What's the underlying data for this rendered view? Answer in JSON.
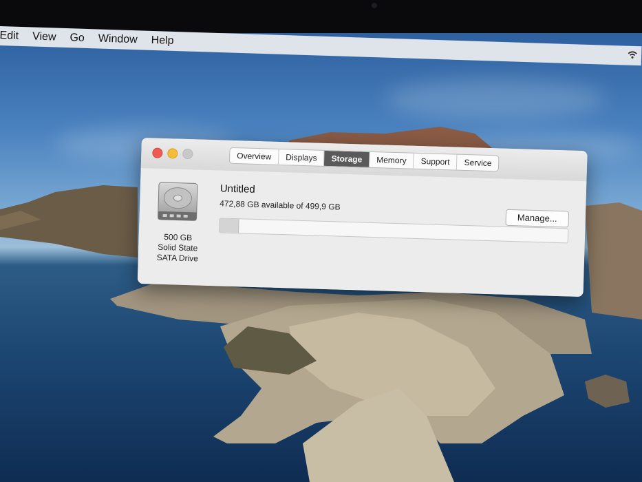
{
  "menubar": {
    "items": [
      "Edit",
      "View",
      "Go",
      "Window",
      "Help"
    ]
  },
  "window": {
    "tabs": [
      {
        "label": "Overview",
        "active": false
      },
      {
        "label": "Displays",
        "active": false
      },
      {
        "label": "Storage",
        "active": true
      },
      {
        "label": "Memory",
        "active": false
      },
      {
        "label": "Support",
        "active": false
      },
      {
        "label": "Service",
        "active": false
      }
    ],
    "disk": {
      "icon": "hard-drive-icon",
      "lines": [
        "500 GB",
        "Solid State",
        "SATA Drive"
      ]
    },
    "volume": {
      "name": "Untitled",
      "available_text": "472,88 GB available of 499,9 GB",
      "used_fraction": 0.054
    },
    "manage_label": "Manage..."
  },
  "colors": {
    "close": "#ed5b54",
    "minimize": "#f3bd3a",
    "zoom": "#c9c9c9",
    "active_tab": "#5a5a5a"
  }
}
